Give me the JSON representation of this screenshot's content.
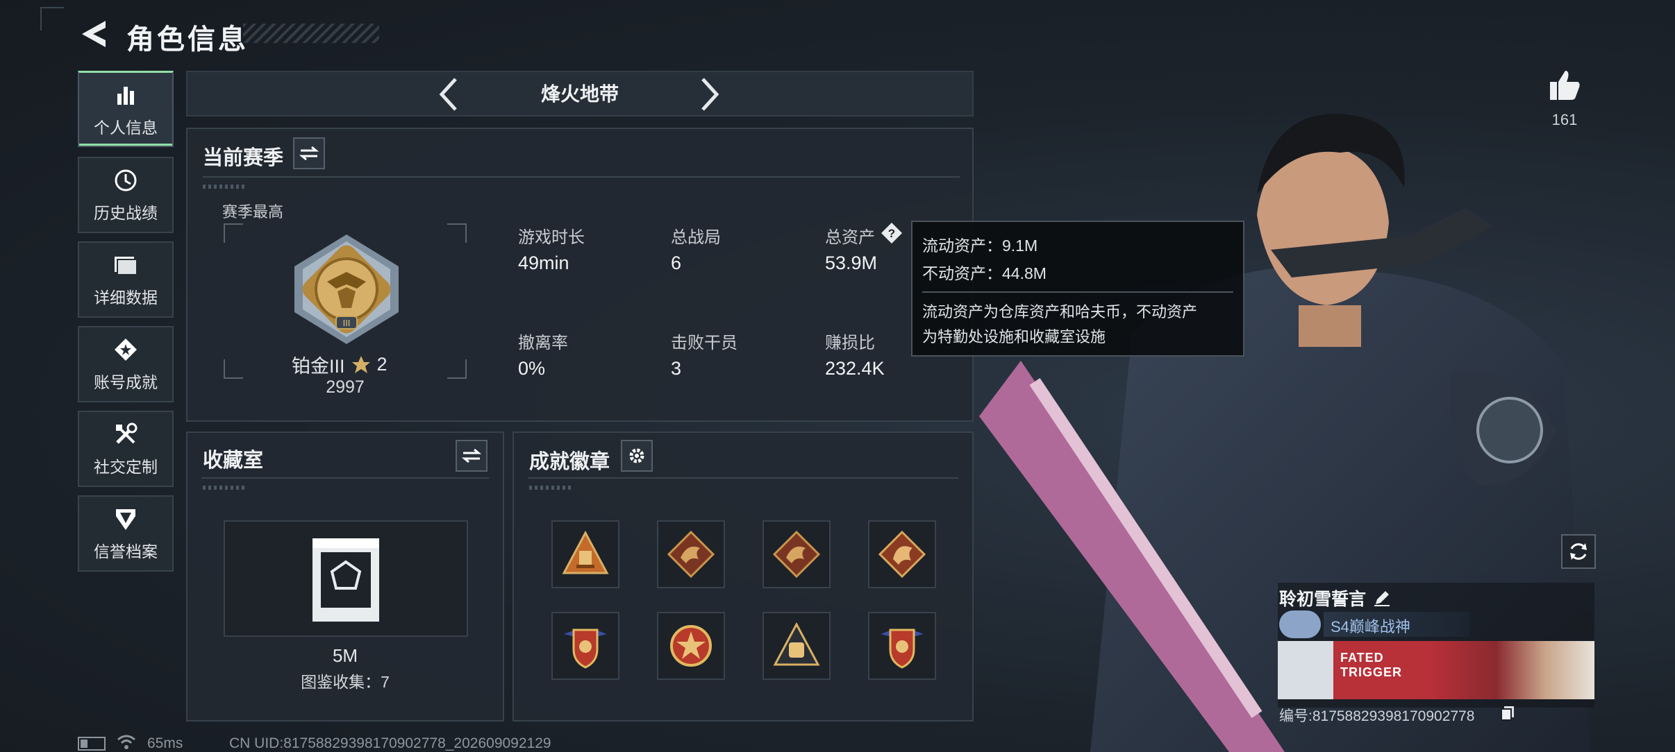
{
  "header": {
    "title": "角色信息"
  },
  "sidebar": {
    "items": [
      {
        "label": "个人信息",
        "icon": "bar-chart-icon",
        "active": true
      },
      {
        "label": "历史战绩",
        "icon": "history-clock-icon",
        "active": false
      },
      {
        "label": "详细数据",
        "icon": "folder-icon",
        "active": false
      },
      {
        "label": "账号成就",
        "icon": "achievement-star-icon",
        "active": false
      },
      {
        "label": "社交定制",
        "icon": "tools-icon",
        "active": false
      },
      {
        "label": "信誉档案",
        "icon": "reputation-shield-icon",
        "active": false
      }
    ]
  },
  "mode": {
    "name": "烽火地带"
  },
  "season": {
    "title": "当前赛季",
    "best_label": "赛季最高",
    "rank_name": "铂金III",
    "rank_stars": "2",
    "rank_score": "2997",
    "stats": [
      {
        "label": "游戏时长",
        "value": "49min"
      },
      {
        "label": "总战局",
        "value": "6"
      },
      {
        "label": "总资产",
        "value": "53.9M"
      },
      {
        "label": "撤离率",
        "value": "0%"
      },
      {
        "label": "击败干员",
        "value": "3"
      },
      {
        "label": "赚损比",
        "value": "232.4K"
      }
    ]
  },
  "tooltip": {
    "liquid": "流动资产：9.1M",
    "fixed": "不动资产：44.8M",
    "desc_1": "流动资产为仓库资产和哈夫币，不动资产",
    "desc_2": "为特勤处设施和收藏室设施"
  },
  "collection": {
    "title": "收藏室",
    "value": "5M",
    "count_text": "图鉴收集：7"
  },
  "achievements": {
    "title": "成就徽章",
    "badges": [
      "triangle-badge",
      "dragon-badge",
      "dragon-badge",
      "dragon-badge",
      "shield-wings-badge",
      "star-emblem-badge",
      "bag-triangle-badge",
      "shield-wings-badge"
    ]
  },
  "profile": {
    "likes": "161",
    "player_name": "聆初雪誓言",
    "title_badge": "S4巅峰战神",
    "card_text": "FATED TRIGGER",
    "serial": "编号:8175882939817090277​8"
  },
  "footer": {
    "ping": "65ms",
    "uid": "CN UID:8175882939817090​2778_202609092129"
  },
  "colors": {
    "accent_green": "#8fe0a6",
    "panel": "#222931",
    "rank_gold": "#c9a55a"
  }
}
